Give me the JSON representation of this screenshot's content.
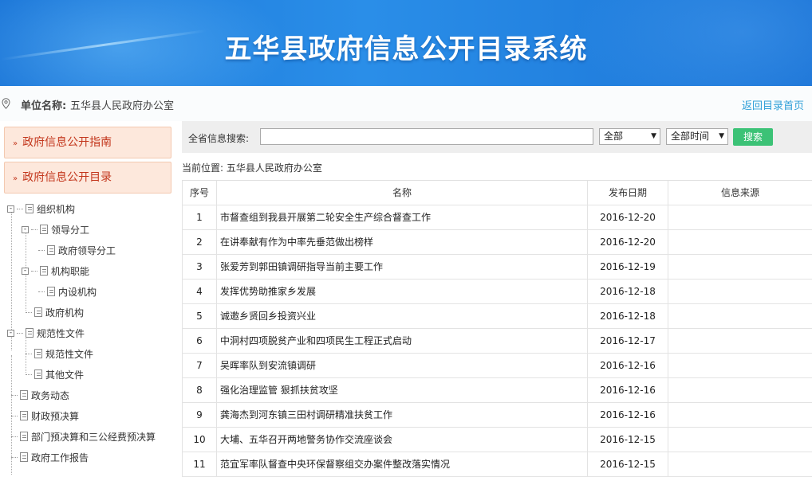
{
  "header": {
    "title": "五华县政府信息公开目录系统"
  },
  "unit": {
    "label": "单位名称:",
    "value": "五华县人民政府办公室",
    "home_link": "返回目录首页"
  },
  "sidebar": {
    "guide_button": "政府信息公开指南",
    "catalog_button": "政府信息公开目录",
    "tree": [
      {
        "label": "组织机构",
        "level": 0,
        "toggle": "-"
      },
      {
        "label": "领导分工",
        "level": 1,
        "toggle": "-"
      },
      {
        "label": "政府领导分工",
        "level": 2
      },
      {
        "label": "机构职能",
        "level": 1,
        "toggle": "-"
      },
      {
        "label": "内设机构",
        "level": 2
      },
      {
        "label": "政府机构",
        "level": 1
      },
      {
        "label": "规范性文件",
        "level": 0,
        "toggle": "-"
      },
      {
        "label": "规范性文件",
        "level": 1
      },
      {
        "label": "其他文件",
        "level": 1
      },
      {
        "label": "政务动态",
        "level": 0
      },
      {
        "label": "财政预决算",
        "level": 0
      },
      {
        "label": "部门预决算和三公经费预决算",
        "level": 0
      },
      {
        "label": "政府工作报告",
        "level": 0
      }
    ]
  },
  "search": {
    "label": "全省信息搜索:",
    "input_value": "",
    "scope_select": "全部",
    "time_select": "全部时间",
    "button": "搜索"
  },
  "breadcrumb": "当前位置: 五华县人民政府办公室",
  "table": {
    "headers": [
      "序号",
      "名称",
      "发布日期",
      "信息来源"
    ],
    "rows": [
      {
        "no": "1",
        "name": "市督查组到我县开展第二轮安全生产综合督查工作",
        "date": "2016-12-20",
        "source": ""
      },
      {
        "no": "2",
        "name": "在讲奉献有作为中率先垂范做出榜样",
        "date": "2016-12-20",
        "source": ""
      },
      {
        "no": "3",
        "name": "张爱芳到郭田镇调研指导当前主要工作",
        "date": "2016-12-19",
        "source": ""
      },
      {
        "no": "4",
        "name": "发挥优势助推家乡发展",
        "date": "2016-12-18",
        "source": ""
      },
      {
        "no": "5",
        "name": "诚邀乡贤回乡投资兴业",
        "date": "2016-12-18",
        "source": ""
      },
      {
        "no": "6",
        "name": "中洞村四项脱贫产业和四项民生工程正式启动",
        "date": "2016-12-17",
        "source": ""
      },
      {
        "no": "7",
        "name": "吴晖率队到安流镇调研",
        "date": "2016-12-16",
        "source": ""
      },
      {
        "no": "8",
        "name": "强化治理监管 狠抓扶贫攻坚",
        "date": "2016-12-16",
        "source": ""
      },
      {
        "no": "9",
        "name": "龚海杰到河东镇三田村调研精准扶贫工作",
        "date": "2016-12-16",
        "source": ""
      },
      {
        "no": "10",
        "name": "大埔、五华召开两地警务协作交流座谈会",
        "date": "2016-12-15",
        "source": ""
      },
      {
        "no": "11",
        "name": "范宜军率队督查中央环保督察组交办案件整改落实情况",
        "date": "2016-12-15",
        "source": ""
      }
    ]
  }
}
